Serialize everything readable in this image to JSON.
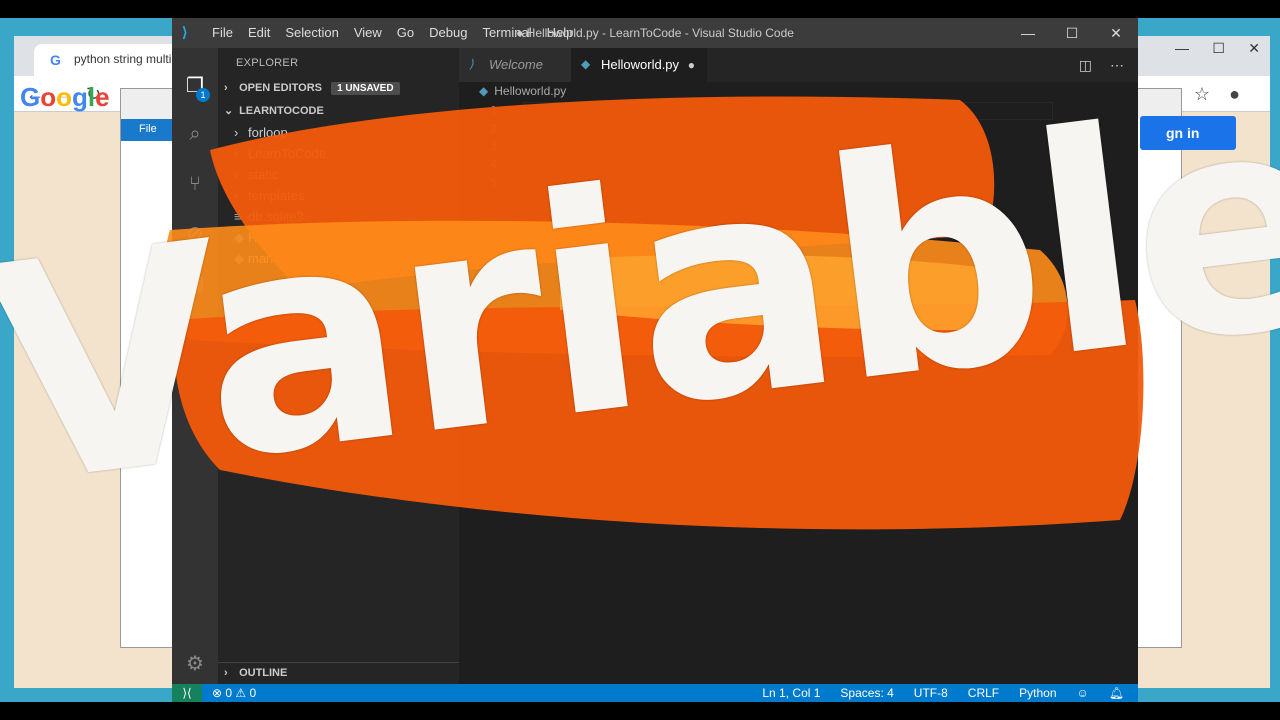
{
  "browser": {
    "tab_title": "python string multiplic",
    "google_logo": "Google",
    "sign_in": "gn in"
  },
  "explorer_window": {
    "file_tab": "File"
  },
  "vscode": {
    "title": "● Helloworld.py - LearnToCode - Visual Studio Code",
    "menu": [
      "File",
      "Edit",
      "Selection",
      "View",
      "Go",
      "Debug",
      "Terminal",
      "Help"
    ],
    "sidebar": {
      "header": "EXPLORER",
      "open_editors_label": "OPEN EDITORS",
      "unsaved_badge": "1 UNSAVED",
      "project_label": "LEARNTOCODE",
      "folders": [
        "forloop",
        "LearnToCode",
        "static",
        "templates"
      ],
      "files": [
        "db.sqlite3",
        "Helloworld.py",
        "manage.py"
      ],
      "outline_label": "OUTLINE"
    },
    "activity_badge": "1",
    "tabs": {
      "welcome": "Welcome",
      "active": "Helloworld.py"
    },
    "breadcrumb": "Helloworld.py",
    "line_numbers": [
      "1",
      "2",
      "3",
      "4",
      "5"
    ],
    "status": {
      "problems": "⊗ 0 ⚠ 0",
      "position": "Ln 1, Col 1",
      "spaces": "Spaces: 4",
      "encoding": "UTF-8",
      "eol": "CRLF",
      "language": "Python"
    }
  },
  "overlay": {
    "title_text": "Variables",
    "colors": {
      "brush_orange": "#f25a0a",
      "brush_light": "#ff8c1a",
      "text": "#f7f5f2"
    }
  }
}
